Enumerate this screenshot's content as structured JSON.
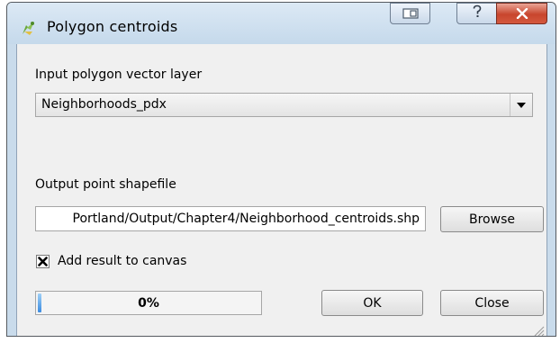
{
  "window": {
    "title": "Polygon centroids",
    "app_icon": "qgis-icon",
    "controls": [
      "restore-icon",
      "help-icon",
      "close-icon"
    ]
  },
  "input_layer": {
    "label": "Input polygon vector layer",
    "selected": "Neighborhoods_pdx"
  },
  "output": {
    "label": "Output point shapefile",
    "value": "Portland/Output/Chapter4/Neighborhood_centroids.shp",
    "browse_label": "Browse"
  },
  "add_to_canvas": {
    "label": "Add result to canvas",
    "checked": true
  },
  "progress": {
    "value": 0,
    "text": "0%"
  },
  "buttons": {
    "ok": "OK",
    "close": "Close"
  },
  "colors": {
    "title_bar": "#c5d9eb",
    "close_button": "#c8452d",
    "progress_fill": "#3b8be0"
  }
}
